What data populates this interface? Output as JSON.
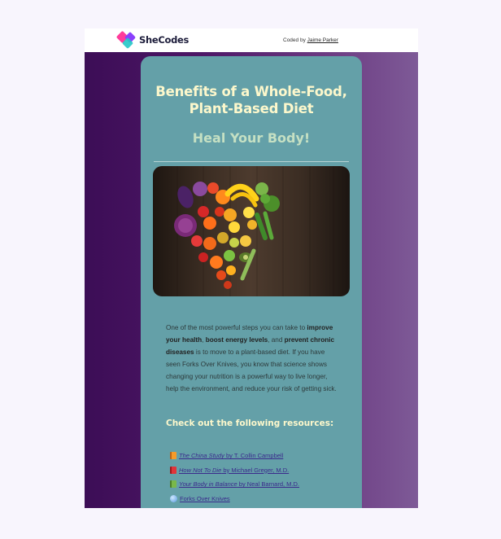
{
  "header": {
    "logo_text": "SheCodes",
    "coded_by_prefix": "Coded by",
    "author": "Jaime Parker"
  },
  "card": {
    "title_line1": "Benefits of a Whole-Food,",
    "title_line2": "Plant-Based Diet",
    "subtitle": "Heal Your Body!",
    "hero_image_alt": "Heart made of fruits and vegetables",
    "paragraph": {
      "p1": "One of the most powerful steps you can take to ",
      "b1": "improve your health",
      "p2": ", ",
      "b2": "boost energy levels",
      "p3": ", and ",
      "b3": "prevent chronic diseases",
      "p4": " is to move to a plant-based diet. If you have seen Forks Over Knives, you know that science shows changing your nutrition is a powerful way to live longer, help the environment, and reduce your risk of getting sick."
    },
    "resources_heading": "Check out the following resources:",
    "resources": [
      {
        "icon": "orange-book-icon",
        "color": "#f59b2b",
        "title": "The China Study",
        "by": " by T. Collin Campbell"
      },
      {
        "icon": "red-book-icon",
        "color": "#e0343a",
        "title": "How Not To Die",
        "by": " by Michael Greger, M.D."
      },
      {
        "icon": "green-book-icon",
        "color": "#79b84a",
        "title": "Your Body in Balance",
        "by": " by Neal Barnard, M.D."
      },
      {
        "icon": "globe-icon",
        "title": "Forks Over Knives",
        "by": ""
      }
    ]
  },
  "colors": {
    "card_bg": "#64a0a8",
    "title": "#fdf8cc",
    "subtitle": "#c5e0c3"
  }
}
